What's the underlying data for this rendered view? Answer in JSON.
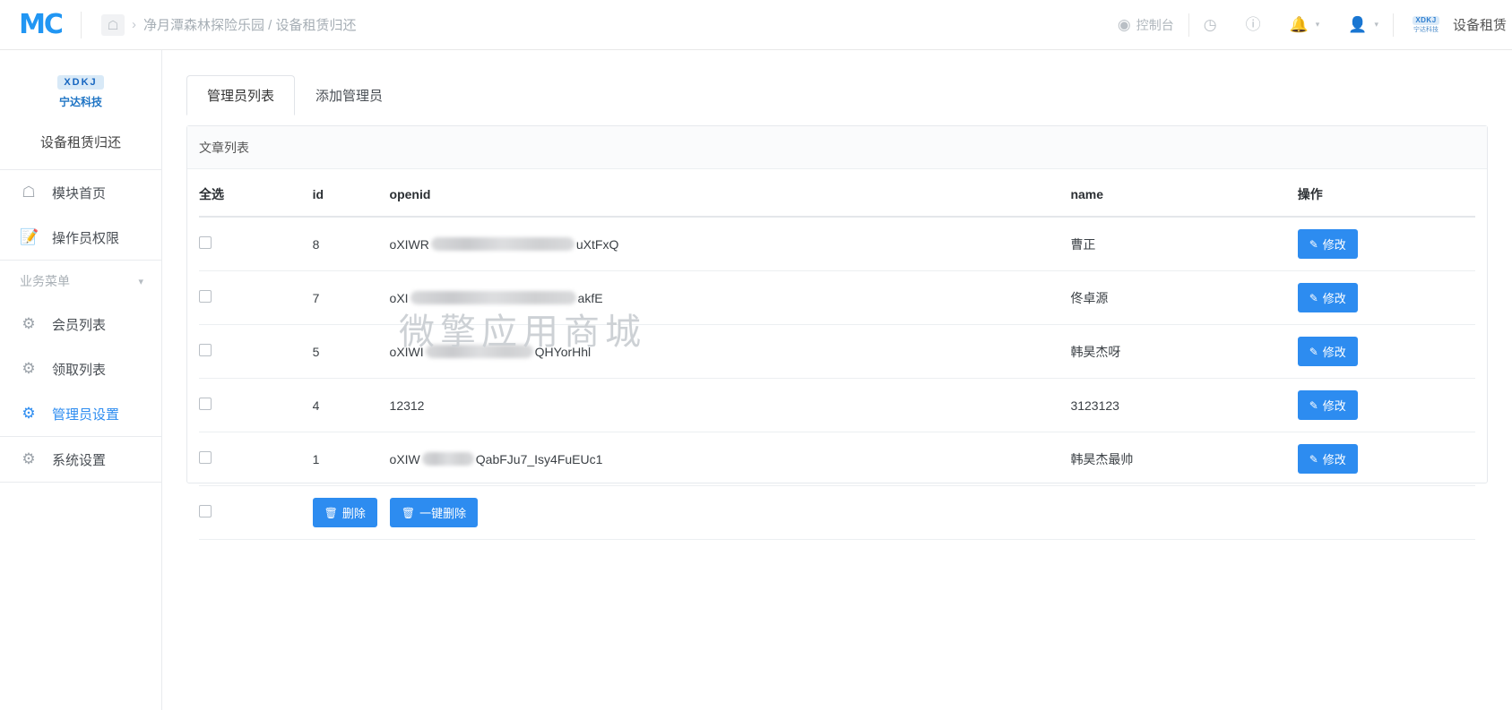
{
  "header": {
    "logo_text": "MC",
    "home_icon": "home-icon",
    "breadcrumb_separator": "›",
    "breadcrumb": "净月潭森林探险乐园 / 设备租赁归还",
    "console_label": "控制台",
    "console_icon": "dashboard-icon",
    "shop_icon": "shop-icon",
    "help_icon": "help-circle-icon",
    "bell_icon": "bell-icon",
    "user_icon": "user-icon",
    "caret": "▾",
    "brand_mini_top": "XDKJ",
    "brand_mini_bottom": "宁达科技",
    "module_name": "设备租赁"
  },
  "sidebar": {
    "logo_top": "XDKJ",
    "logo_bottom": "宁达科技",
    "title": "设备租赁归还",
    "items": [
      {
        "label": "模块首页",
        "icon": "home-icon",
        "active": false
      },
      {
        "label": "操作员权限",
        "icon": "document-edit-icon",
        "active": false
      }
    ],
    "group_label": "业务菜单",
    "group_chevron": "⌄",
    "sub_items": [
      {
        "label": "会员列表",
        "icon": "gear-icon",
        "active": false
      },
      {
        "label": "领取列表",
        "icon": "gear-icon",
        "active": false
      },
      {
        "label": "管理员设置",
        "icon": "gear-icon",
        "active": true
      },
      {
        "label": "系统设置",
        "icon": "gear-icon",
        "active": false
      }
    ]
  },
  "main": {
    "tabs": [
      {
        "label": "管理员列表",
        "active": true
      },
      {
        "label": "添加管理员",
        "active": false
      }
    ],
    "panel_title": "文章列表",
    "columns": {
      "select_all": "全选",
      "id": "id",
      "openid": "openid",
      "name": "name",
      "action": "操作"
    },
    "rows": [
      {
        "id": "8",
        "openid_prefix": "oXIWR",
        "openid_suffix": "uXtFxQ",
        "redacted": true,
        "name": "曹正",
        "action": "修改"
      },
      {
        "id": "7",
        "openid_prefix": "oXI",
        "openid_suffix": "akfE",
        "redacted": true,
        "name": "佟卓源",
        "action": "修改"
      },
      {
        "id": "5",
        "openid_prefix": "oXIWI",
        "openid_suffix": "QHYorHhl",
        "redacted": true,
        "name": "韩昊杰呀",
        "action": "修改"
      },
      {
        "id": "4",
        "openid_prefix": "12312",
        "openid_suffix": "",
        "redacted": false,
        "name": "3123123",
        "action": "修改"
      },
      {
        "id": "1",
        "openid_prefix": "oXIW",
        "openid_suffix": "QabFJu7_Isy4FuEUc1",
        "redacted": true,
        "name": "韩昊杰最帅",
        "action": "修改"
      }
    ],
    "delete_button": "删除",
    "delete_icon": "trash-icon",
    "bulk_delete_button": "一键删除",
    "bulk_delete_icon": "trash-icon",
    "edit_icon": "pencil-square-icon",
    "watermark": "微擎应用商城"
  },
  "colors": {
    "primary": "#2d8cf0",
    "logo_blue": "#2196f3",
    "text": "#3b4045",
    "muted": "#a6aeb5",
    "border": "#e6e9ed"
  }
}
